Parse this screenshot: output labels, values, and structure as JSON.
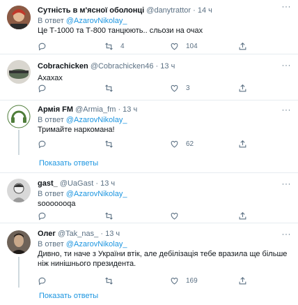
{
  "tweets": [
    {
      "name": "Сутність в м'ясної оболонці",
      "handle": "@danytrattor",
      "time": "14 ч",
      "reply_prefix": "В ответ",
      "reply_mention": "@AzarovNikolay_",
      "text": "Це Т-1000 та Т-800 танцюють.. сльози на очах",
      "replies": "",
      "retweets": "4",
      "likes": "104",
      "avatar_color": "#7a4a3a"
    },
    {
      "name": "Cobrachicken",
      "handle": "@Cobrachicken46",
      "time": "13 ч",
      "text": "Ахахах",
      "replies": "",
      "retweets": "",
      "likes": "3",
      "avatar_color": "#5a6b55"
    },
    {
      "name": "Армія FM",
      "handle": "@Armia_fm",
      "time": "13 ч",
      "reply_prefix": "В ответ",
      "reply_mention": "@AzarovNikolay_",
      "text": "Тримайте наркомана!",
      "replies": "",
      "retweets": "",
      "likes": "62",
      "avatar_color": "#4f7d3a"
    },
    {
      "name": "gast_",
      "handle": "@UaGast",
      "time": "13 ч",
      "reply_prefix": "В ответ",
      "reply_mention": "@AzarovNikolay_",
      "text": "sooooooqa",
      "replies": "",
      "retweets": "",
      "likes": "",
      "avatar_color": "#b9b9b9"
    },
    {
      "name": "Олег",
      "handle": "@Tak_nas_",
      "time": "13 ч",
      "reply_prefix": "В ответ",
      "reply_mention": "@AzarovNikolay_",
      "text": "Дивно, ти наче з України втік, але дебілізація тебе вразила ще більше ніж нинішнього президента.",
      "replies": "",
      "retweets": "",
      "likes": "169",
      "avatar_color": "#3b3530"
    }
  ],
  "show_replies_label": "Показать ответы",
  "colors": {
    "accent": "#1b95e0",
    "muted": "#5b7083",
    "border": "#e6ecf0"
  }
}
